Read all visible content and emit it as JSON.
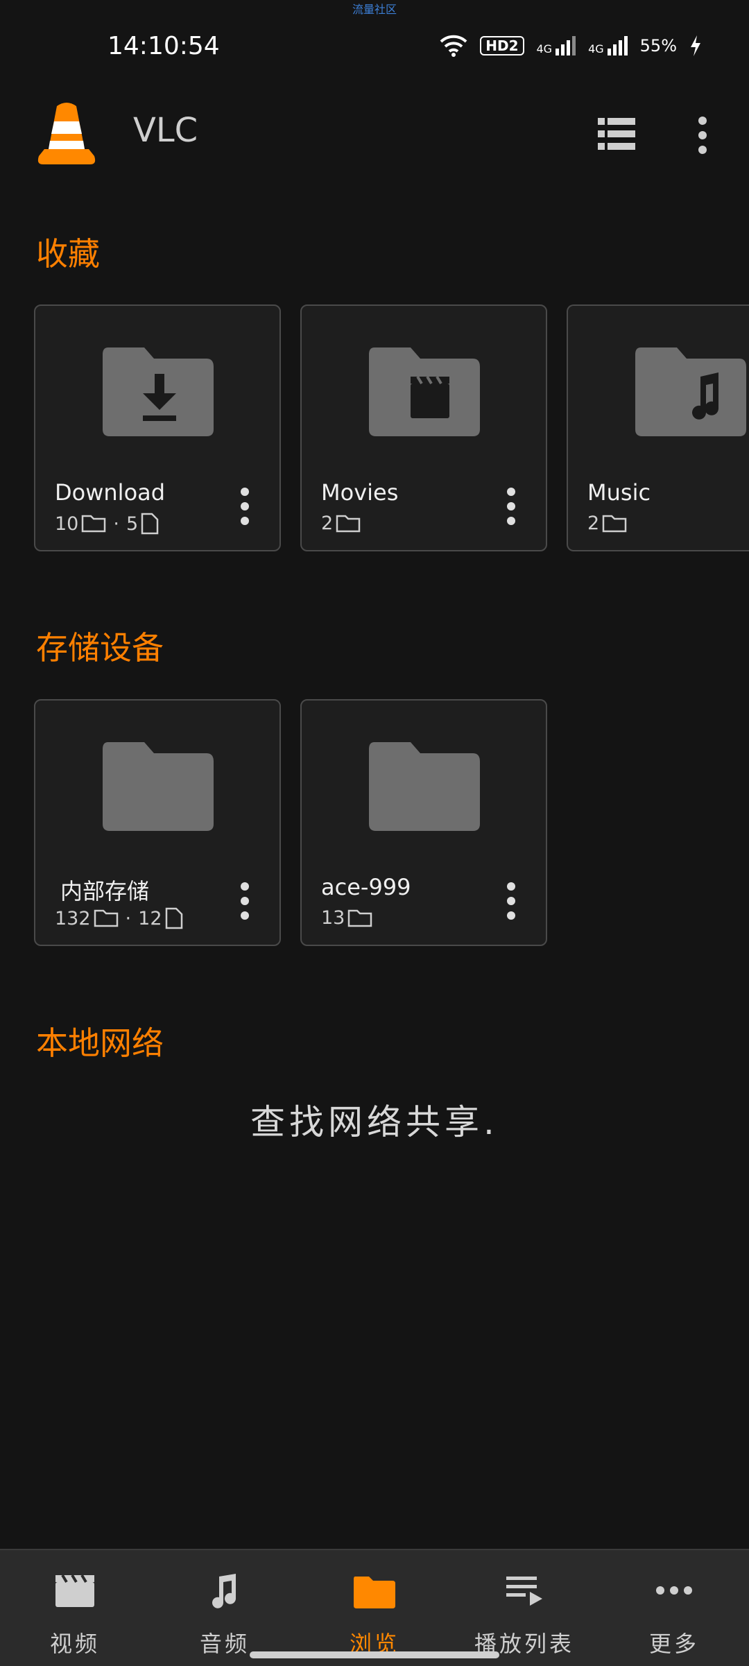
{
  "top_banner": "流量社区",
  "status_bar": {
    "time": "14:10:54",
    "hd": "HD2",
    "net1": "4G",
    "net2": "4G",
    "battery": "55%"
  },
  "app_bar": {
    "title": "VLC"
  },
  "sections": {
    "favorites": "收藏",
    "storage": "存储设备",
    "network": "本地网络"
  },
  "favorites": [
    {
      "name": "Download",
      "folders": "10",
      "files": "5"
    },
    {
      "name": "Movies",
      "folders": "2"
    },
    {
      "name": "Music",
      "folders": "2"
    }
  ],
  "storage": [
    {
      "name": "内部存储",
      "folders": "132",
      "files": "12"
    },
    {
      "name": "ace-999",
      "folders": "13"
    }
  ],
  "network_message": "查找网络共享.",
  "bottom_nav": [
    {
      "label": "视频",
      "icon": "clapperboard-icon"
    },
    {
      "label": "音频",
      "icon": "music-note-icon"
    },
    {
      "label": "浏览",
      "icon": "folder-icon",
      "active": true
    },
    {
      "label": "播放列表",
      "icon": "playlist-icon"
    },
    {
      "label": "更多",
      "icon": "more-horizontal-icon"
    }
  ],
  "colors": {
    "accent": "#ff8000",
    "background": "#141414",
    "card": "#1e1e1e"
  }
}
